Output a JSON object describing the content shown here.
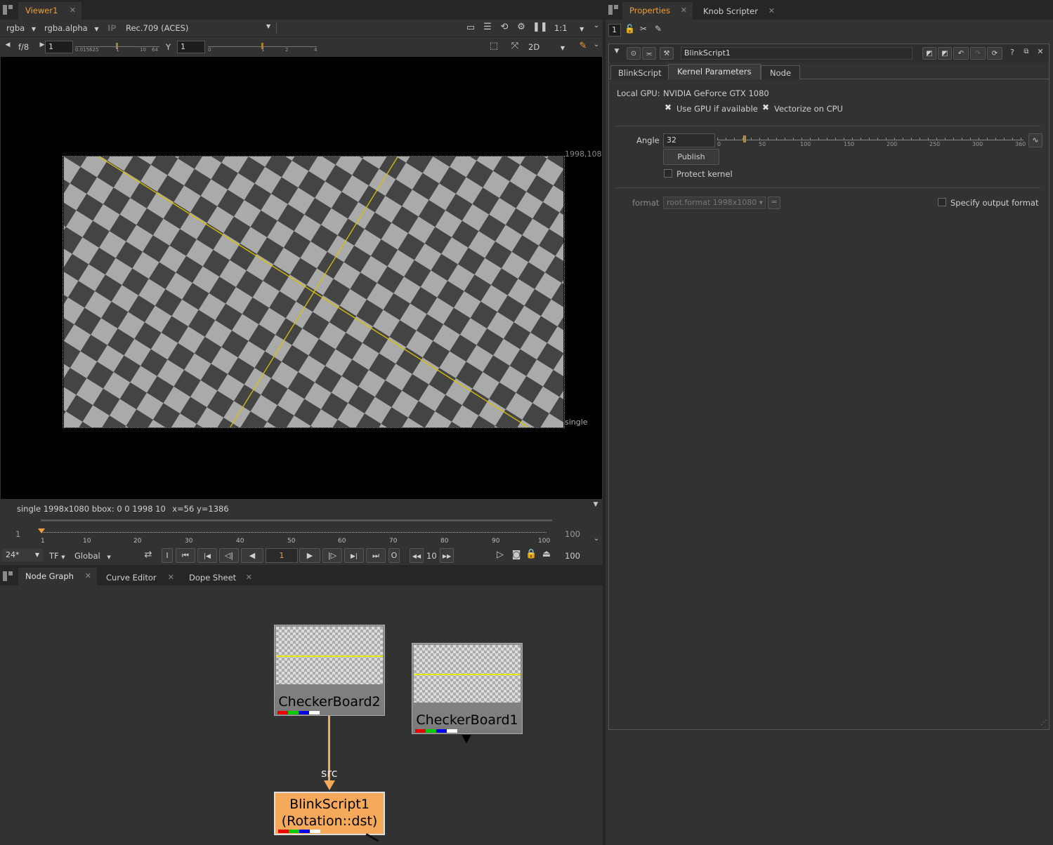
{
  "viewer": {
    "tab_label": "Viewer1",
    "channels": "rgba",
    "alpha_channel": "rgba.alpha",
    "ip_label": "IP",
    "colorspace": "Rec.709 (ACES)",
    "zoom": "1:1",
    "fstop": "f/8",
    "gain_value": "1",
    "gain_ticks": [
      "0.015625",
      "1",
      "10",
      "64"
    ],
    "gamma_label": "Y",
    "gamma_value": "1",
    "gamma_ticks": [
      "0",
      "1",
      "2",
      "4"
    ],
    "view_mode": "2D",
    "format_corner_label": "1998,108",
    "overlay_label": "single",
    "status_text": "single 1998x1080  bbox: 0 0 1998 10  x=56 y=1386"
  },
  "timeline": {
    "start_frame": "1",
    "end_frame": "100",
    "ticks": [
      "1",
      "10",
      "20",
      "30",
      "40",
      "50",
      "60",
      "70",
      "80",
      "90",
      "100"
    ],
    "current_frame": "1",
    "fps": "24*",
    "tf": "TF",
    "scope": "Global",
    "in_label": "I",
    "out_label": "O",
    "skip_frames": "10",
    "out_frame": "100"
  },
  "node_graph": {
    "tabs": [
      "Node Graph",
      "Curve Editor",
      "Dope Sheet"
    ],
    "nodes": {
      "checker2": "CheckerBoard2",
      "checker1": "CheckerBoard1",
      "blink_line1": "BlinkScript1",
      "blink_line2": "(Rotation::dst)"
    },
    "edge_label": "src",
    "colors": {
      "blink_node": "#f5a95a",
      "edge": "#f5a95a"
    }
  },
  "properties": {
    "tabs": [
      "Properties",
      "Knob Scripter"
    ],
    "max_panels": "1",
    "node_name": "BlinkScript1",
    "sub_tabs": [
      "BlinkScript",
      "Kernel Parameters",
      "Node"
    ],
    "local_gpu_label": "Local GPU:",
    "local_gpu_value": "NVIDIA GeForce GTX 1080",
    "use_gpu_label": "Use GPU if available",
    "use_gpu": true,
    "vectorize_label": "Vectorize on CPU",
    "vectorize": true,
    "angle_label": "Angle",
    "angle_value": "32",
    "angle_ticks": [
      "0",
      "50",
      "100",
      "150",
      "200",
      "250",
      "300",
      "360"
    ],
    "publish_label": "Publish",
    "protect_label": "Protect kernel",
    "format_label": "format",
    "format_value": "root.format 1998x1080",
    "specify_format_label": "Specify output format",
    "accent_color": "#f0a030"
  }
}
